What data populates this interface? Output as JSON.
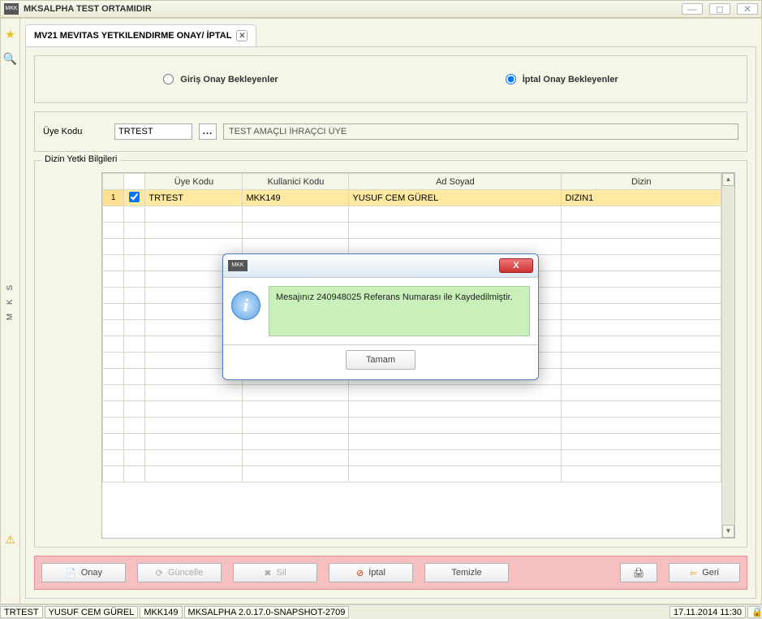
{
  "window": {
    "title": "MKSALPHA TEST ORTAMIDIR",
    "logo": "MKK"
  },
  "tab": {
    "label": "MV21 MEVITAS YETKILENDIRME ONAY/ İPTAL"
  },
  "radios": {
    "giris": "Giriş Onay Bekleyenler",
    "iptal": "İptal Onay Bekleyenler",
    "selected": "iptal"
  },
  "uye": {
    "label": "Üye Kodu",
    "code": "TRTEST",
    "desc": "TEST AMAÇLI İHRAÇCI ÜYE"
  },
  "grid": {
    "legend": "Dizin Yetki Bilgileri",
    "headers": {
      "uye": "Üye Kodu",
      "kul": "Kullanici Kodu",
      "ad": "Ad Soyad",
      "diz": "Dizin"
    },
    "rows": [
      {
        "num": "1",
        "checked": true,
        "uye": "TRTEST",
        "kul": "MKK149",
        "ad": "YUSUF CEM GÜREL",
        "diz": "DIZIN1"
      }
    ]
  },
  "buttons": {
    "onay": "Onay",
    "guncelle": "Güncelle",
    "sil": "Sil",
    "iptal": "İptal",
    "temizle": "Temizle",
    "geri": "Geri"
  },
  "modal": {
    "message": "Mesajınız 240948025 Referans Numarası ile Kaydedilmiştir.",
    "ok": "Tamam"
  },
  "status": {
    "c1": "TRTEST",
    "c2": "YUSUF CEM GÜREL",
    "c3": "MKK149",
    "c4": "MKSALPHA 2.0.17.0-SNAPSHOT-2709",
    "datetime": "17.11.2014 11:30"
  },
  "sidebar": {
    "vtext": "M K S"
  }
}
